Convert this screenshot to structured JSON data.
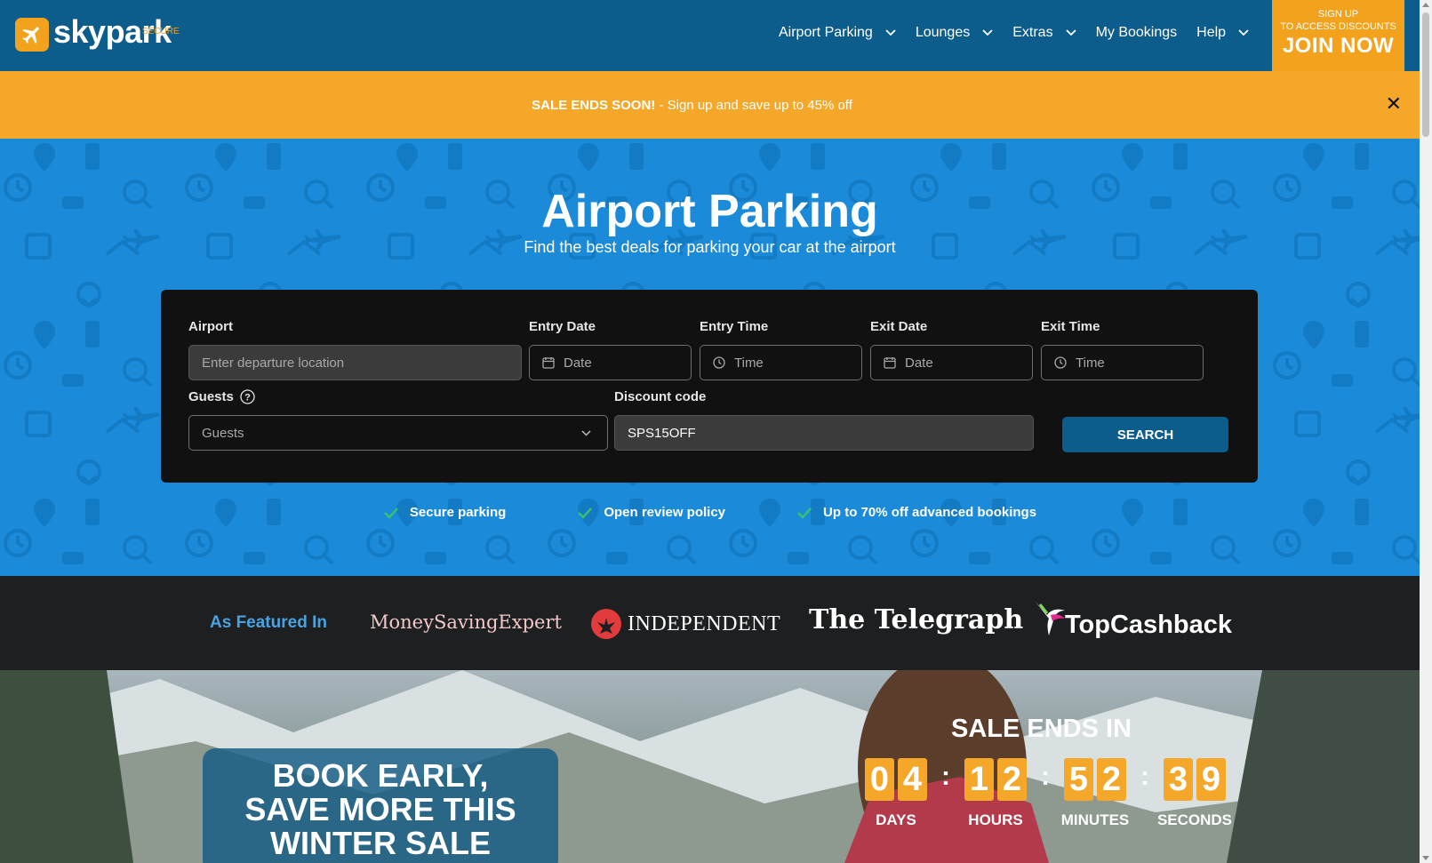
{
  "header": {
    "logo_text": "skypark",
    "logo_sub": "SECURE",
    "nav": [
      {
        "label": "Airport Parking",
        "dropdown": true
      },
      {
        "label": "Lounges",
        "dropdown": true
      },
      {
        "label": "Extras",
        "dropdown": true
      },
      {
        "label": "My Bookings",
        "dropdown": false
      },
      {
        "label": "Help",
        "dropdown": true
      }
    ],
    "join": {
      "line1": "SIGN UP",
      "line2": "TO ACCESS DISCOUNTS",
      "line3": "JOIN NOW"
    }
  },
  "promo": {
    "bold": "SALE ENDS SOON!",
    "text": " - Sign up and save up to 45% off",
    "close_icon": "close-icon"
  },
  "hero": {
    "title": "Airport Parking",
    "subtitle": "Find the best deals for parking your car at the airport"
  },
  "search": {
    "airport_label": "Airport",
    "airport_placeholder": "Enter departure location",
    "entry_date_label": "Entry Date",
    "entry_date_placeholder": "Date",
    "entry_time_label": "Entry Time",
    "entry_time_placeholder": "Time",
    "exit_date_label": "Exit Date",
    "exit_date_placeholder": "Date",
    "exit_time_label": "Exit Time",
    "exit_time_placeholder": "Time",
    "guests_label": "Guests",
    "guests_value": "Guests",
    "discount_label": "Discount code",
    "discount_value": "SPS15OFF",
    "button": "SEARCH"
  },
  "features": [
    "Secure parking",
    "Open review policy",
    "Up to 70% off advanced bookings"
  ],
  "featured": {
    "label": "As Featured In",
    "brands": [
      "MoneySavingExpert",
      "INDEPENDENT",
      "The Telegraph",
      "TopCashback"
    ]
  },
  "promo_card": {
    "line1": "BOOK EARLY,",
    "line2": "SAVE MORE THIS",
    "line3": "WINTER SALE"
  },
  "countdown": {
    "title": "SALE ENDS IN",
    "units": [
      {
        "digits": [
          "0",
          "4"
        ],
        "label": "DAYS"
      },
      {
        "digits": [
          "1",
          "2"
        ],
        "label": "HOURS"
      },
      {
        "digits": [
          "5",
          "2"
        ],
        "label": "MINUTES"
      },
      {
        "digits": [
          "3",
          "9"
        ],
        "label": "SECONDS"
      }
    ]
  },
  "colors": {
    "brand_blue": "#0c5c8c",
    "hero_blue": "#1a8ad9",
    "accent_orange": "#f3a21d",
    "check_green": "#3cc26b"
  }
}
